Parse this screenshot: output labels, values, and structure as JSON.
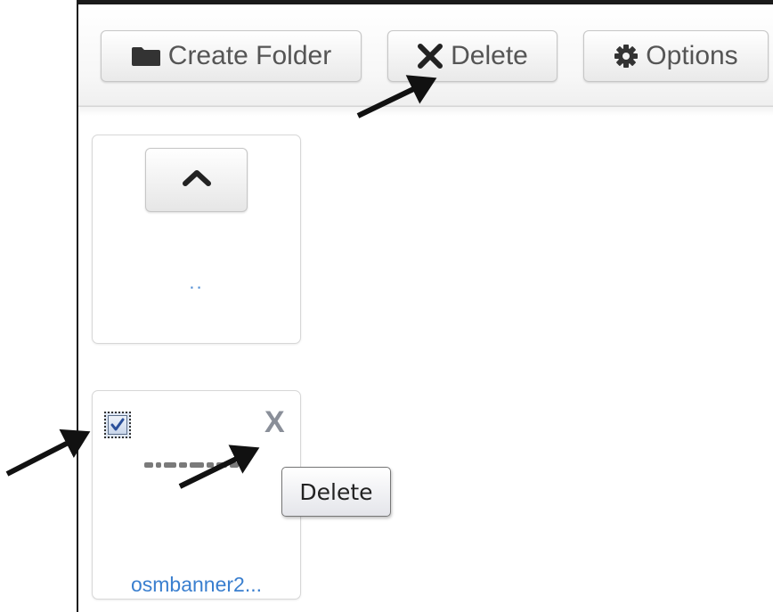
{
  "toolbar": {
    "create_folder_label": "Create Folder",
    "delete_label": "Delete",
    "options_label": "Options"
  },
  "browser": {
    "parent_folder_label": "..",
    "file": {
      "name": "osmbanner2...",
      "checked": true,
      "delete_glyph": "X"
    }
  },
  "tooltip": {
    "text": "Delete"
  },
  "icons": {
    "create_folder": "folder-icon",
    "delete": "x-icon",
    "options": "gear-icon",
    "up": "chevron-up-icon"
  },
  "colors": {
    "link": "#3a7fcf",
    "button_text": "#555555",
    "arrow": "#111111"
  }
}
